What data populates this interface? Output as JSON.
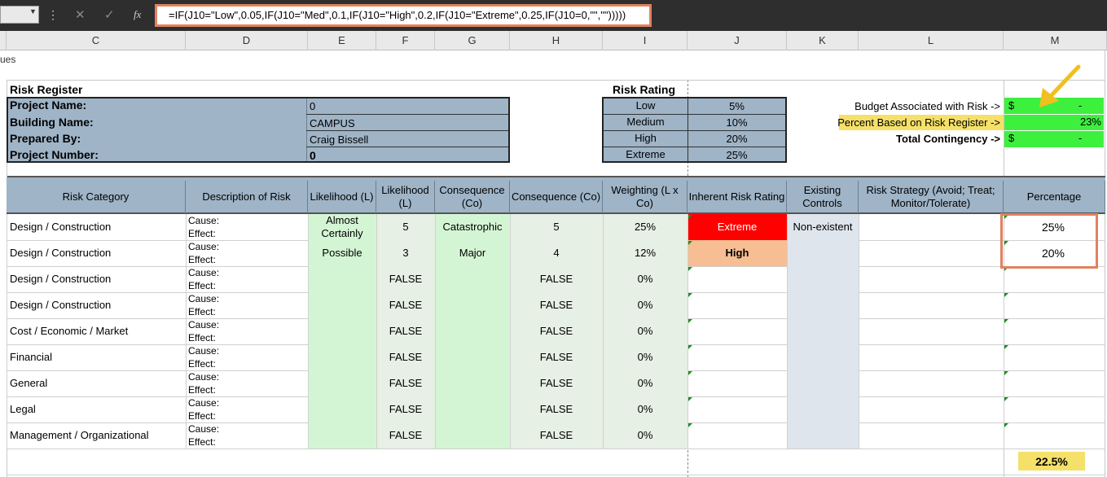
{
  "formula_bar": {
    "formula": "=IF(J10=\"Low\",0.05,IF(J10=\"Med\",0.1,IF(J10=\"High\",0.2,IF(J10=\"Extreme\",0.25,IF(J10=0,\"\",\"\")))))",
    "fx_label": "fx"
  },
  "columns": [
    "C",
    "D",
    "E",
    "F",
    "G",
    "H",
    "I",
    "J",
    "K",
    "L",
    "M"
  ],
  "sheet_tab_fragment": "ues",
  "header": {
    "title": "Risk Register",
    "project_name_label": "Project Name:",
    "project_name_value": "0",
    "building_name_label": "Building Name:",
    "building_name_value": "CAMPUS",
    "prepared_by_label": "Prepared By:",
    "prepared_by_value": "Craig Bissell",
    "project_number_label": "Project Number:",
    "project_number_value": "0"
  },
  "risk_rating": {
    "title": "Risk Rating",
    "rows": [
      {
        "label": "Low",
        "value": "5%"
      },
      {
        "label": "Medium",
        "value": "10%"
      },
      {
        "label": "High",
        "value": "20%"
      },
      {
        "label": "Extreme",
        "value": "25%"
      }
    ]
  },
  "budget": {
    "budget_label": "Budget Associated with Risk ->",
    "budget_currency": "$",
    "budget_value": "-",
    "percent_label": "Percent Based on Risk Register ->",
    "percent_value": "23%",
    "contingency_label": "Total Contingency ->",
    "contingency_currency": "$",
    "contingency_value": "-"
  },
  "table": {
    "headers": [
      "Risk Category",
      "Description of Risk",
      "Likelihood (L)",
      "Likelihood (L)",
      "Consequence (Co)",
      "Consequence (Co)",
      "Weighting (L x Co)",
      "Inherent Risk Rating",
      "Existing Controls",
      "Risk Strategy (Avoid; Treat; Monitor/Tolerate)",
      "Percentage"
    ],
    "cause_label": "Cause:",
    "effect_label": "Effect:",
    "rows": [
      {
        "category": "Design / Construction",
        "likelihood": "Almost Certainly",
        "l_num": "5",
        "consequence": "Catastrophic",
        "c_num": "5",
        "weighting": "25%",
        "rating": "Extreme",
        "controls": "Non-existent",
        "percentage": "25%"
      },
      {
        "category": "Design / Construction",
        "likelihood": "Possible",
        "l_num": "3",
        "consequence": "Major",
        "c_num": "4",
        "weighting": "12%",
        "rating": "High",
        "controls": "",
        "percentage": "20%"
      },
      {
        "category": "Design / Construction",
        "likelihood": "",
        "l_num": "FALSE",
        "consequence": "",
        "c_num": "FALSE",
        "weighting": "0%",
        "rating": "",
        "controls": "",
        "percentage": ""
      },
      {
        "category": "Design / Construction",
        "likelihood": "",
        "l_num": "FALSE",
        "consequence": "",
        "c_num": "FALSE",
        "weighting": "0%",
        "rating": "",
        "controls": "",
        "percentage": ""
      },
      {
        "category": "Cost / Economic / Market",
        "likelihood": "",
        "l_num": "FALSE",
        "consequence": "",
        "c_num": "FALSE",
        "weighting": "0%",
        "rating": "",
        "controls": "",
        "percentage": ""
      },
      {
        "category": "Financial",
        "likelihood": "",
        "l_num": "FALSE",
        "consequence": "",
        "c_num": "FALSE",
        "weighting": "0%",
        "rating": "",
        "controls": "",
        "percentage": ""
      },
      {
        "category": "General",
        "likelihood": "",
        "l_num": "FALSE",
        "consequence": "",
        "c_num": "FALSE",
        "weighting": "0%",
        "rating": "",
        "controls": "",
        "percentage": ""
      },
      {
        "category": "Legal",
        "likelihood": "",
        "l_num": "FALSE",
        "consequence": "",
        "c_num": "FALSE",
        "weighting": "0%",
        "rating": "",
        "controls": "",
        "percentage": ""
      },
      {
        "category": "Management / Organizational",
        "likelihood": "",
        "l_num": "FALSE",
        "consequence": "",
        "c_num": "FALSE",
        "weighting": "0%",
        "rating": "",
        "controls": "",
        "percentage": ""
      }
    ],
    "total_percentage": "22.5%"
  },
  "colors": {
    "highlight_outline": "#e0825f",
    "arrow": "#f0c020",
    "extreme": "#ff0000",
    "high": "#f6be92"
  }
}
